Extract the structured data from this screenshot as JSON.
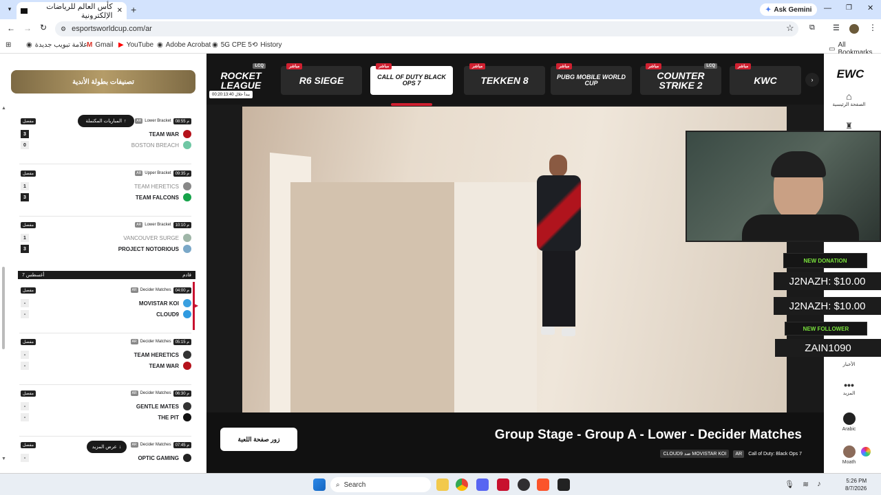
{
  "browser": {
    "tab_title": "كأس العالم للرياضات الإلكترونية",
    "url": "esportsworldcup.com/ar",
    "ask_gemini": "Ask Gemini",
    "bookmarks": [
      "علامة تبويب جديدة",
      "Gmail",
      "YouTube",
      "Adobe Acrobat",
      "5G CPE 5",
      "History"
    ],
    "all_bookmarks": "All Bookmarks"
  },
  "left_panel": {
    "rankings_button": "تصنيفات بطولة الأندية",
    "completed_matches": "المباريات المكتملة",
    "date_header_left": "أغسطس 7",
    "date_header_right": "قادم",
    "show_more": "عرض المزيد",
    "details_label": "مفصل",
    "ar_label": "AR",
    "matches": [
      {
        "time": "08:55 م",
        "stage": "Lower Bracket",
        "teams": [
          {
            "name": "TEAM WAR",
            "score": "3",
            "win": true,
            "color": "#b5121b"
          },
          {
            "name": "BOSTON BREACH",
            "score": "0",
            "win": false,
            "color": "#6fc7a4"
          }
        ]
      },
      {
        "time": "09:35 م",
        "stage": "Upper Bracket",
        "teams": [
          {
            "name": "TEAM HERETICS",
            "score": "1",
            "win": false,
            "color": "#888888"
          },
          {
            "name": "TEAM FALCONS",
            "score": "3",
            "win": true,
            "color": "#16a34a"
          }
        ]
      },
      {
        "time": "10:10 م",
        "stage": "Lower Bracket",
        "teams": [
          {
            "name": "VANCOUVER SURGE",
            "score": "1",
            "win": false,
            "color": "#9fb6a8"
          },
          {
            "name": "PROJECT NOTORIOUS",
            "score": "3",
            "win": true,
            "color": "#7aa8c8"
          }
        ]
      },
      {
        "time": "04:00 م",
        "stage": "Decider Matches",
        "teams": [
          {
            "name": "MOVISTAR KOI",
            "score": "-",
            "win": false,
            "color": "#3aa0e0"
          },
          {
            "name": "CLOUD9",
            "score": "-",
            "win": false,
            "color": "#2f9ae0"
          }
        ]
      },
      {
        "time": "05:15 م",
        "stage": "Decider Matches",
        "teams": [
          {
            "name": "TEAM HERETICS",
            "score": "-",
            "win": false,
            "color": "#333333"
          },
          {
            "name": "TEAM WAR",
            "score": "-",
            "win": false,
            "color": "#b5121b"
          }
        ]
      },
      {
        "time": "06:30 م",
        "stage": "Decider Matches",
        "teams": [
          {
            "name": "GENTLE MATES",
            "score": "-",
            "win": false,
            "color": "#333333"
          },
          {
            "name": "THE PIT",
            "score": "-",
            "win": false,
            "color": "#111111"
          }
        ]
      },
      {
        "time": "07:45 م",
        "stage": "Decider Matches",
        "teams": [
          {
            "name": "OPTIC GAMING",
            "score": "-",
            "win": false,
            "color": "#222222"
          }
        ]
      }
    ]
  },
  "games_strip": {
    "live_label": "مباشر",
    "lcq_label": "LCQ",
    "countdown": "يبدأ خلال 00:20:13:40",
    "games": [
      {
        "name": "ROCKET LEAGUE",
        "live": false,
        "lcq": true
      },
      {
        "name": "R6 SIEGE",
        "live": true,
        "lcq": false
      },
      {
        "name": "CALL OF DUTY BLACK OPS 7",
        "live": true,
        "lcq": false,
        "active": true
      },
      {
        "name": "TEKKEN 8",
        "live": true,
        "lcq": false
      },
      {
        "name": "PUBG MOBILE WORLD CUP",
        "live": true,
        "lcq": false
      },
      {
        "name": "COUNTER STRIKE 2",
        "live": true,
        "lcq": true
      },
      {
        "name": "KWC",
        "live": true,
        "lcq": false
      }
    ]
  },
  "stream": {
    "title": "Group Stage - Group A - Lower - Decider Matches",
    "visit_game_page": "زور صفحة اللعبة",
    "game_name": "Call of Duty: Black Ops 7",
    "teams_tag": "CLOUD9 ضد MOVISTAR KOI",
    "ar_tag": "AR"
  },
  "overlay": {
    "new_donation": "NEW DONATION",
    "donation_1": "J2NAZH: $10.00",
    "donation_2": "J2NAZH: $10.00",
    "new_follower": "NEW FOLLOWER",
    "follower": "ZAIN1090"
  },
  "right_nav": {
    "logo": "EWC",
    "home": "الصفحة الرئيسية",
    "news": "الأخبار",
    "more": "المزيد",
    "language": "Arabic",
    "user": "Moath"
  },
  "taskbar": {
    "search_placeholder": "Search",
    "time": "5:26 PM",
    "date": "8/7/2026"
  }
}
